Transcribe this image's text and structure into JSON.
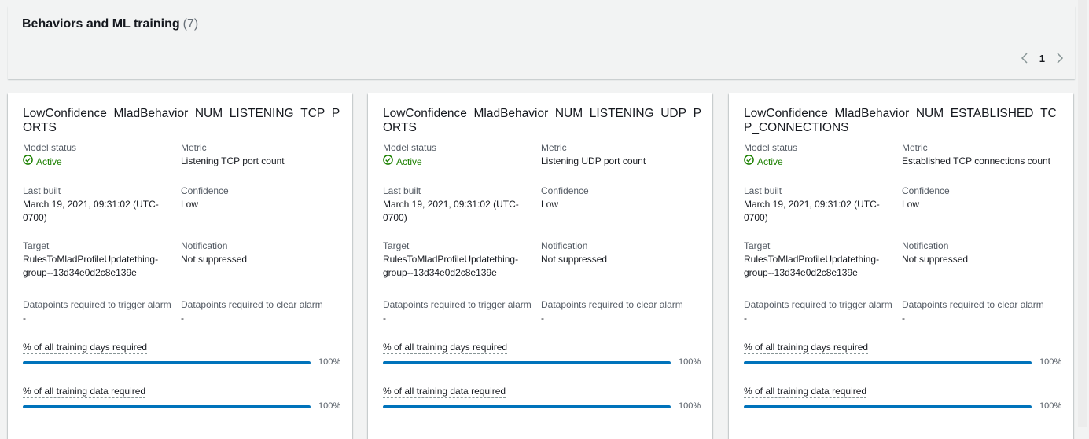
{
  "section": {
    "title": "Behaviors and ML training",
    "count": "(7)"
  },
  "pagination": {
    "prev_icon": "chevron-left-icon",
    "next_icon": "chevron-right-icon",
    "current_page": "1"
  },
  "labels": {
    "model_status": "Model status",
    "metric": "Metric",
    "last_built": "Last built",
    "confidence": "Confidence",
    "target": "Target",
    "notification": "Notification",
    "dp_trigger": "Datapoints required to trigger alarm",
    "dp_clear": "Datapoints required to clear alarm",
    "training_days": "% of all training days required",
    "training_data": "% of all training data required"
  },
  "colors": {
    "active": "#1d8102",
    "progress": "#0073bb"
  },
  "cards": [
    {
      "title": "LowConfidence_MladBehavior_NUM_LISTENING_TCP_PORTS",
      "model_status": "Active",
      "metric": "Listening TCP port count",
      "last_built": "March 19, 2021, 09:31:02 (UTC-0700)",
      "confidence": "Low",
      "target": "RulesToMladProfileUpdatething-group--13d34e0d2c8e139e",
      "notification": "Not suppressed",
      "dp_trigger": "-",
      "dp_clear": "-",
      "training_days_percent": 100,
      "training_days_text": "100%",
      "training_data_percent": 100,
      "training_data_text": "100%"
    },
    {
      "title": "LowConfidence_MladBehavior_NUM_LISTENING_UDP_PORTS",
      "model_status": "Active",
      "metric": "Listening UDP port count",
      "last_built": "March 19, 2021, 09:31:02 (UTC-0700)",
      "confidence": "Low",
      "target": "RulesToMladProfileUpdatething-group--13d34e0d2c8e139e",
      "notification": "Not suppressed",
      "dp_trigger": "-",
      "dp_clear": "-",
      "training_days_percent": 100,
      "training_days_text": "100%",
      "training_data_percent": 100,
      "training_data_text": "100%"
    },
    {
      "title": "LowConfidence_MladBehavior_NUM_ESTABLISHED_TCP_CONNECTIONS",
      "model_status": "Active",
      "metric": "Established TCP connections count",
      "last_built": "March 19, 2021, 09:31:02 (UTC-0700)",
      "confidence": "Low",
      "target": "RulesToMladProfileUpdatething-group--13d34e0d2c8e139e",
      "notification": "Not suppressed",
      "dp_trigger": "-",
      "dp_clear": "-",
      "training_days_percent": 100,
      "training_days_text": "100%",
      "training_data_percent": 100,
      "training_data_text": "100%"
    }
  ]
}
